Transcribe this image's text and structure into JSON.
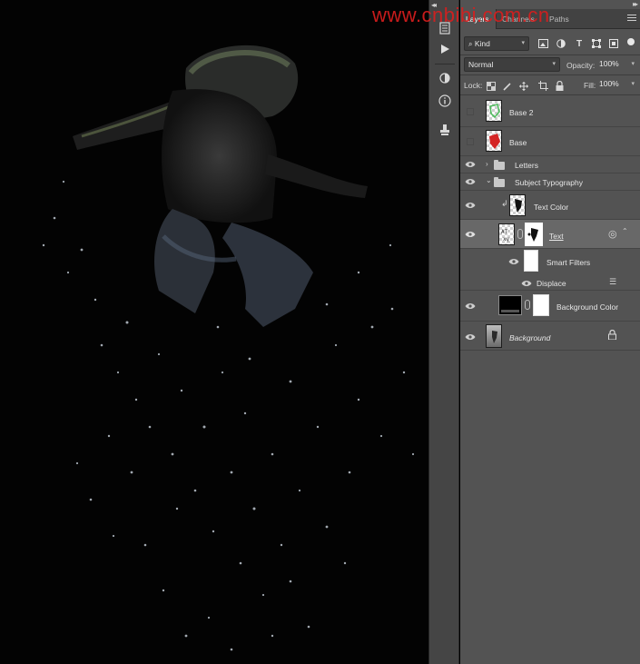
{
  "watermark": "www.cnbibi.com.cn",
  "toolbar": {
    "collapse_left": "◂◂",
    "collapse_right": "▸▸",
    "tools": [
      "history-icon",
      "play-icon",
      "adjust-icon",
      "info-icon",
      "clone-stamp-icon"
    ]
  },
  "tabs": [
    {
      "label": "Layers",
      "active": true
    },
    {
      "label": "Channels",
      "active": false
    },
    {
      "label": "Paths",
      "active": false
    }
  ],
  "filter": {
    "kind_label": "Kind",
    "icons": [
      "image-filter-icon",
      "adjustment-filter-icon",
      "type-filter-icon",
      "shape-filter-icon",
      "smart-object-filter-icon"
    ]
  },
  "blend": {
    "mode": "Normal",
    "opacity_label": "Opacity:",
    "opacity_value": "100%"
  },
  "lock": {
    "label": "Lock:",
    "fill_label": "Fill:",
    "fill_value": "100%"
  },
  "layers": [
    {
      "name": "Base 2",
      "visible": false
    },
    {
      "name": "Base",
      "visible": false
    },
    {
      "name": "Letters",
      "visible": true,
      "type": "group",
      "expanded": false
    },
    {
      "name": "Subject Typography",
      "visible": true,
      "type": "group",
      "expanded": true
    },
    {
      "name": "Text Color",
      "visible": true,
      "clipped": true
    },
    {
      "name": "Text",
      "visible": true,
      "selected": true,
      "smart": true
    },
    {
      "name": "Smart Filters",
      "visible": true
    },
    {
      "name": "Displace",
      "visible": true
    },
    {
      "name": "Background Color",
      "visible": true
    },
    {
      "name": "Background",
      "visible": true,
      "locked": true
    }
  ],
  "colors": {
    "panel": "#535353",
    "selected": "#686868",
    "canvas": "#030303",
    "watermark": "#d81e1e"
  }
}
